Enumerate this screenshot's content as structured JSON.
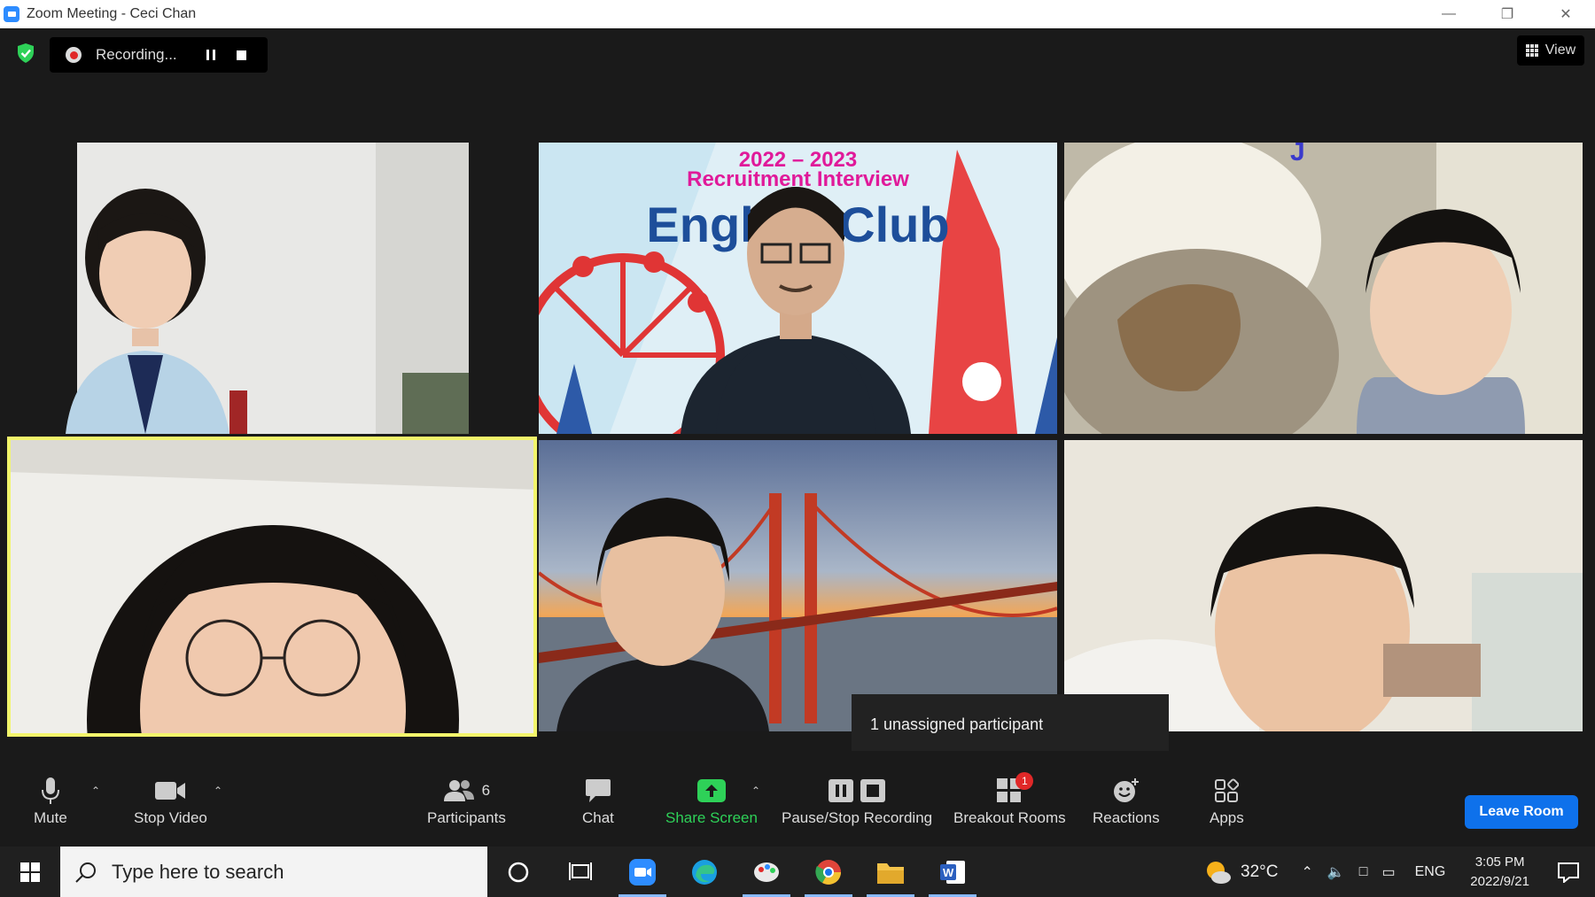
{
  "window": {
    "title": "Zoom Meeting - Ceci Chan",
    "controls": [
      "minimize-icon",
      "restore-icon",
      "close-icon"
    ]
  },
  "recording": {
    "label": "Recording..."
  },
  "view_button": {
    "label": "View"
  },
  "video_tiles": [
    {
      "banner_line1": "",
      "banner_line2": "",
      "banner_line3": ""
    },
    {
      "banner_line1": "2022 – 2023",
      "banner_line2": "Recruitment Interview",
      "banner_line3": "English Club"
    },
    {},
    {},
    {},
    {}
  ],
  "tooltip": {
    "text": "1 unassigned participant"
  },
  "toolbar": {
    "mute": "Mute",
    "stop_video": "Stop Video",
    "participants": "Participants",
    "participants_count": "6",
    "chat": "Chat",
    "share_screen": "Share Screen",
    "pause_stop_recording": "Pause/Stop Recording",
    "breakout_rooms": "Breakout Rooms",
    "breakout_badge": "1",
    "reactions": "Reactions",
    "apps": "Apps",
    "leave_room": "Leave Room"
  },
  "taskbar": {
    "search_placeholder": "Type here to search",
    "weather_temp": "32°C",
    "language": "ENG",
    "time": "3:05 PM",
    "date": "2022/9/21"
  },
  "colors": {
    "zoom_blue": "#0e71eb",
    "active_speaker": "#f2f56b",
    "share_green": "#2ed158",
    "badge_red": "#e02828"
  }
}
